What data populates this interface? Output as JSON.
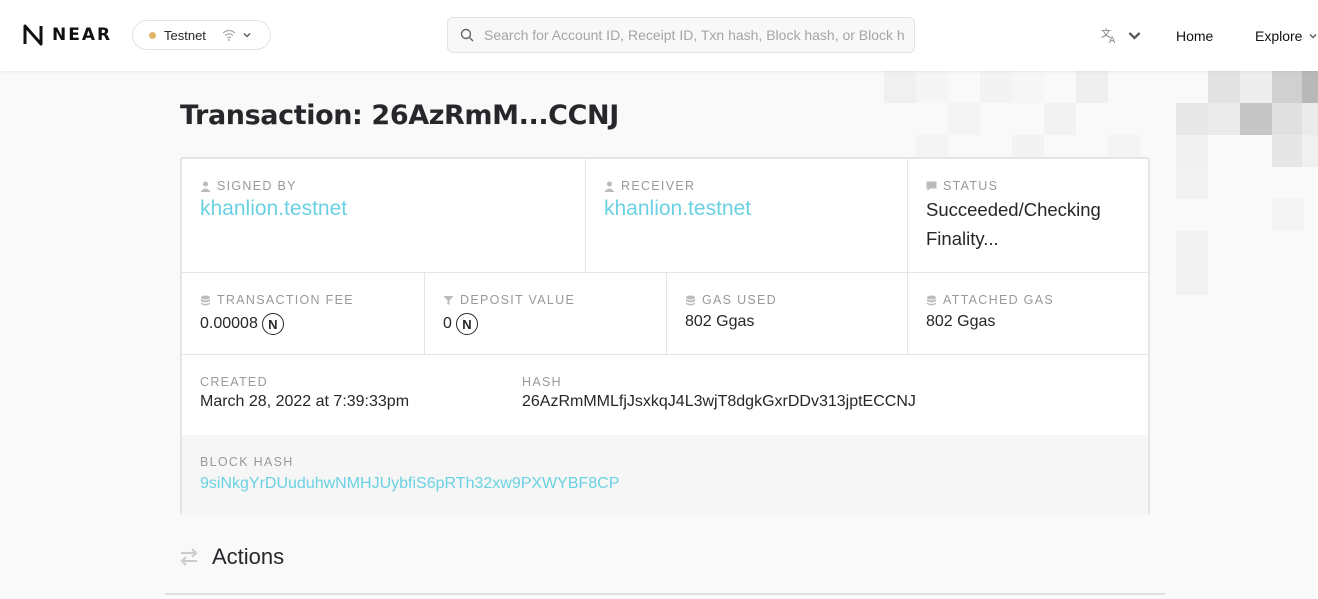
{
  "header": {
    "logo_text": "NEAR",
    "network_label": "Testnet",
    "search_placeholder": "Search for Account ID, Receipt ID, Txn hash, Block hash, or Block height",
    "nav_home": "Home",
    "nav_explore": "Explore"
  },
  "page": {
    "title": "Transaction: 26AzRmM...CCNJ"
  },
  "transaction": {
    "signed_by_label": "SIGNED BY",
    "signed_by": "khanlion.testnet",
    "receiver_label": "RECEIVER",
    "receiver": "khanlion.testnet",
    "status_label": "STATUS",
    "status": "Succeeded/Checking Finality...",
    "fee_label": "TRANSACTION FEE",
    "fee": "0.00008",
    "deposit_label": "DEPOSIT VALUE",
    "deposit": "0",
    "gas_used_label": "GAS USED",
    "gas_used": "802 Ggas",
    "attached_gas_label": "ATTACHED GAS",
    "attached_gas": "802 Ggas",
    "created_label": "CREATED",
    "created": "March 28, 2022 at 7:39:33pm",
    "hash_label": "HASH",
    "hash": "26AzRmMMLfjJsxkqJ4L3wjT8dgkGxrDDv313jptECCNJ",
    "block_hash_label": "BLOCK HASH",
    "block_hash": "9siNkgYrDUuduhwNMHJUybfiS6pRTh32xw9PXWYBF8CP",
    "near_symbol": "N"
  },
  "actions": {
    "heading": "Actions"
  },
  "colors": {
    "link": "#6ad1e3",
    "network_dot": "#e0b76a",
    "text": "#25272a",
    "label": "#999999"
  },
  "icons": {
    "logo": "near-logo-icon",
    "wifi": "wifi-icon",
    "search": "search-icon",
    "language": "translate-icon",
    "user": "user-icon",
    "status": "comment-icon",
    "coins": "coins-icon",
    "filter": "filter-icon",
    "near_token": "near-token-icon",
    "actions": "arrows-exchange-icon"
  }
}
